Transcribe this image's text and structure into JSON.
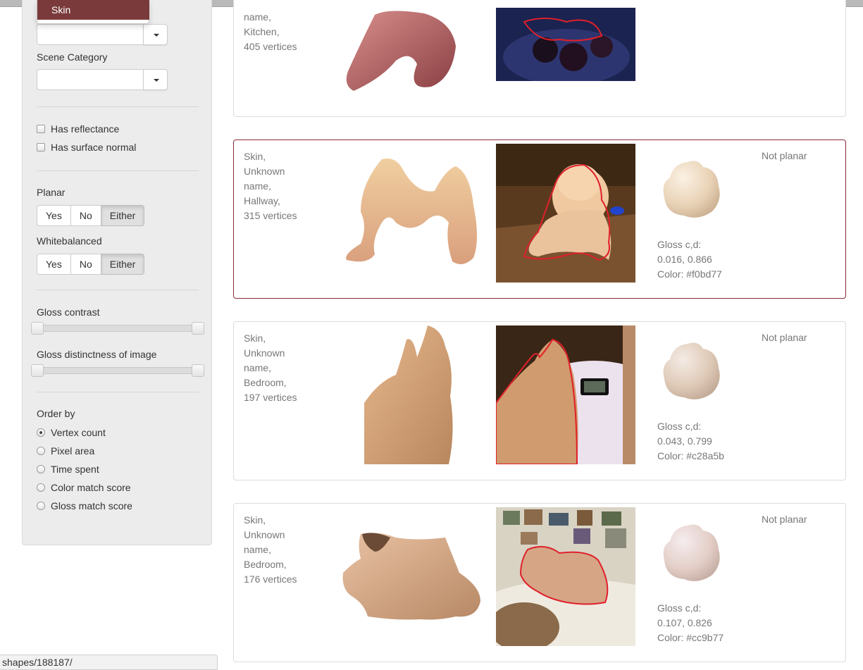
{
  "sidebar": {
    "dropdown_selected": "Skin",
    "scene_category_label": "Scene Category",
    "has_reflectance_label": "Has reflectance",
    "has_surface_normal_label": "Has surface normal",
    "planar": {
      "label": "Planar",
      "options": [
        "Yes",
        "No",
        "Either"
      ],
      "selected": "Either"
    },
    "whitebalanced": {
      "label": "Whitebalanced",
      "options": [
        "Yes",
        "No",
        "Either"
      ],
      "selected": "Either"
    },
    "gloss_contrast_label": "Gloss contrast",
    "gloss_distinctness_label": "Gloss distinctness of image",
    "order_by": {
      "label": "Order by",
      "options": [
        "Vertex count",
        "Pixel area",
        "Time spent",
        "Color match score",
        "Gloss match score"
      ],
      "selected": "Vertex count"
    }
  },
  "cards": [
    {
      "meta": [
        "name,",
        "Kitchen,",
        "405 vertices"
      ]
    },
    {
      "meta": [
        "Skin,",
        "Unknown",
        "name,",
        "Hallway,",
        "315 vertices"
      ],
      "planar": "Not planar",
      "gloss_label": "Gloss c,d:",
      "gloss_values": "0.016, 0.866",
      "color_line": "Color: #f0bd77",
      "sphere_color": "#f0bd77"
    },
    {
      "meta": [
        "Skin,",
        "Unknown",
        "name,",
        "Bedroom,",
        "197 vertices"
      ],
      "planar": "Not planar",
      "gloss_label": "Gloss c,d:",
      "gloss_values": "0.043, 0.799",
      "color_line": "Color: #c28a5b",
      "sphere_color": "#c28a5b"
    },
    {
      "meta": [
        "Skin,",
        "Unknown",
        "name,",
        "Bedroom,",
        "176 vertices"
      ],
      "planar": "Not planar",
      "gloss_label": "Gloss c,d:",
      "gloss_values": "0.107, 0.826",
      "color_line": "Color: #cc9b77",
      "sphere_color": "#cc9b77"
    }
  ],
  "status_url": "shapes/188187/"
}
